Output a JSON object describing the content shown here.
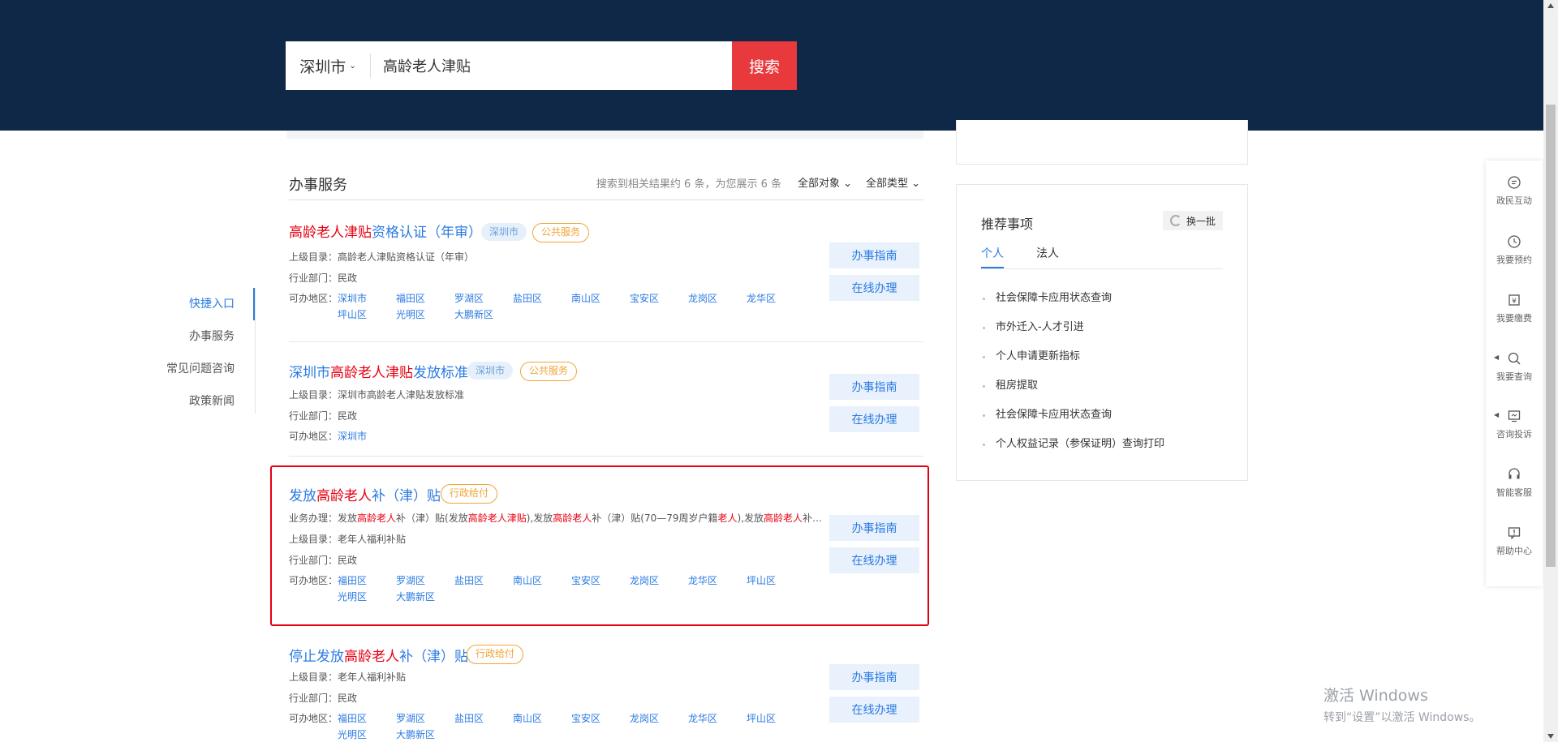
{
  "search": {
    "city": "深圳市",
    "query": "高龄老人津贴",
    "button": "搜索"
  },
  "side_nav": [
    {
      "label": "快捷入口",
      "active": true
    },
    {
      "label": "办事服务",
      "active": false
    },
    {
      "label": "常见问题咨询",
      "active": false
    },
    {
      "label": "政策新闻",
      "active": false
    }
  ],
  "section": {
    "title": "办事服务",
    "result_text": "搜索到相关结果约 6 条，为您展示 6 条",
    "filter_object": "全部对象",
    "filter_type": "全部类型"
  },
  "labels": {
    "parent": "上级目录：",
    "dept": "行业部门：",
    "region": "可办地区：",
    "business": "业务办理：",
    "guide": "办事指南",
    "online": "在线办理"
  },
  "cards": [
    {
      "title_hl": "高龄老人津贴",
      "title_rest": "资格认证（年审）",
      "tag_city": "深圳市",
      "tag_type": "公共服务",
      "parent": "高龄老人津贴资格认证（年审）",
      "dept": "民政",
      "regions": [
        "深圳市",
        "福田区",
        "罗湖区",
        "盐田区",
        "南山区",
        "宝安区",
        "龙岗区",
        "龙华区",
        "坪山区",
        "光明区",
        "大鹏新区"
      ]
    },
    {
      "title_pre": "深圳市",
      "title_hl": "高龄老人津贴",
      "title_rest": "发放标准",
      "tag_city": "深圳市",
      "tag_type": "公共服务",
      "parent": "深圳市高龄老人津贴发放标准",
      "dept": "民政",
      "regions": [
        "深圳市"
      ]
    },
    {
      "title_pre": "发放",
      "title_hl": "高龄老人",
      "title_rest": "补（津）贴",
      "tag_type": "行政给付",
      "business": [
        "发放",
        "高龄老人",
        "补（津）贴(发放",
        "高龄老人津贴",
        "),发放",
        "高龄老人",
        "补（津）贴(70—79周岁户籍",
        "老人",
        "),发放",
        "高龄老人",
        "补…"
      ],
      "parent": "老年人福利补贴",
      "dept": "民政",
      "regions": [
        "福田区",
        "罗湖区",
        "盐田区",
        "南山区",
        "宝安区",
        "龙岗区",
        "龙华区",
        "坪山区",
        "光明区",
        "大鹏新区"
      ]
    },
    {
      "title_pre": "停止发放",
      "title_hl": "高龄老人",
      "title_rest": "补（津）贴",
      "tag_type": "行政给付",
      "parent": "老年人福利补贴",
      "dept": "民政",
      "regions": [
        "福田区",
        "罗湖区",
        "盐田区",
        "南山区",
        "宝安区",
        "龙岗区",
        "龙华区",
        "坪山区",
        "光明区",
        "大鹏新区"
      ]
    }
  ],
  "recommend": {
    "title": "推荐事项",
    "refresh": "换一批",
    "tabs": [
      "个人",
      "法人"
    ],
    "items": [
      "社会保障卡应用状态查询",
      "市外迁入-人才引进",
      "个人申请更新指标",
      "租房提取",
      "社会保障卡应用状态查询",
      "个人权益记录（参保证明）查询打印"
    ]
  },
  "float_bar": [
    {
      "label": "政民互动",
      "icon": "chat-icon"
    },
    {
      "label": "我要预约",
      "icon": "clock-icon"
    },
    {
      "label": "我要缴费",
      "icon": "payment-icon"
    },
    {
      "label": "我要查询",
      "icon": "search-icon"
    },
    {
      "label": "咨询投诉",
      "icon": "monitor-icon"
    },
    {
      "label": "智能客服",
      "icon": "headset-icon"
    },
    {
      "label": "帮助中心",
      "icon": "help-icon"
    }
  ],
  "watermark": {
    "line1": "激活 Windows",
    "line2": "转到“设置”以激活 Windows。"
  },
  "colors": {
    "header_bg": "#0f2847",
    "accent_red": "#e8393d",
    "link_blue": "#2a7ae2",
    "highlight_red": "#e60012",
    "tag_orange": "#f2a43a"
  }
}
